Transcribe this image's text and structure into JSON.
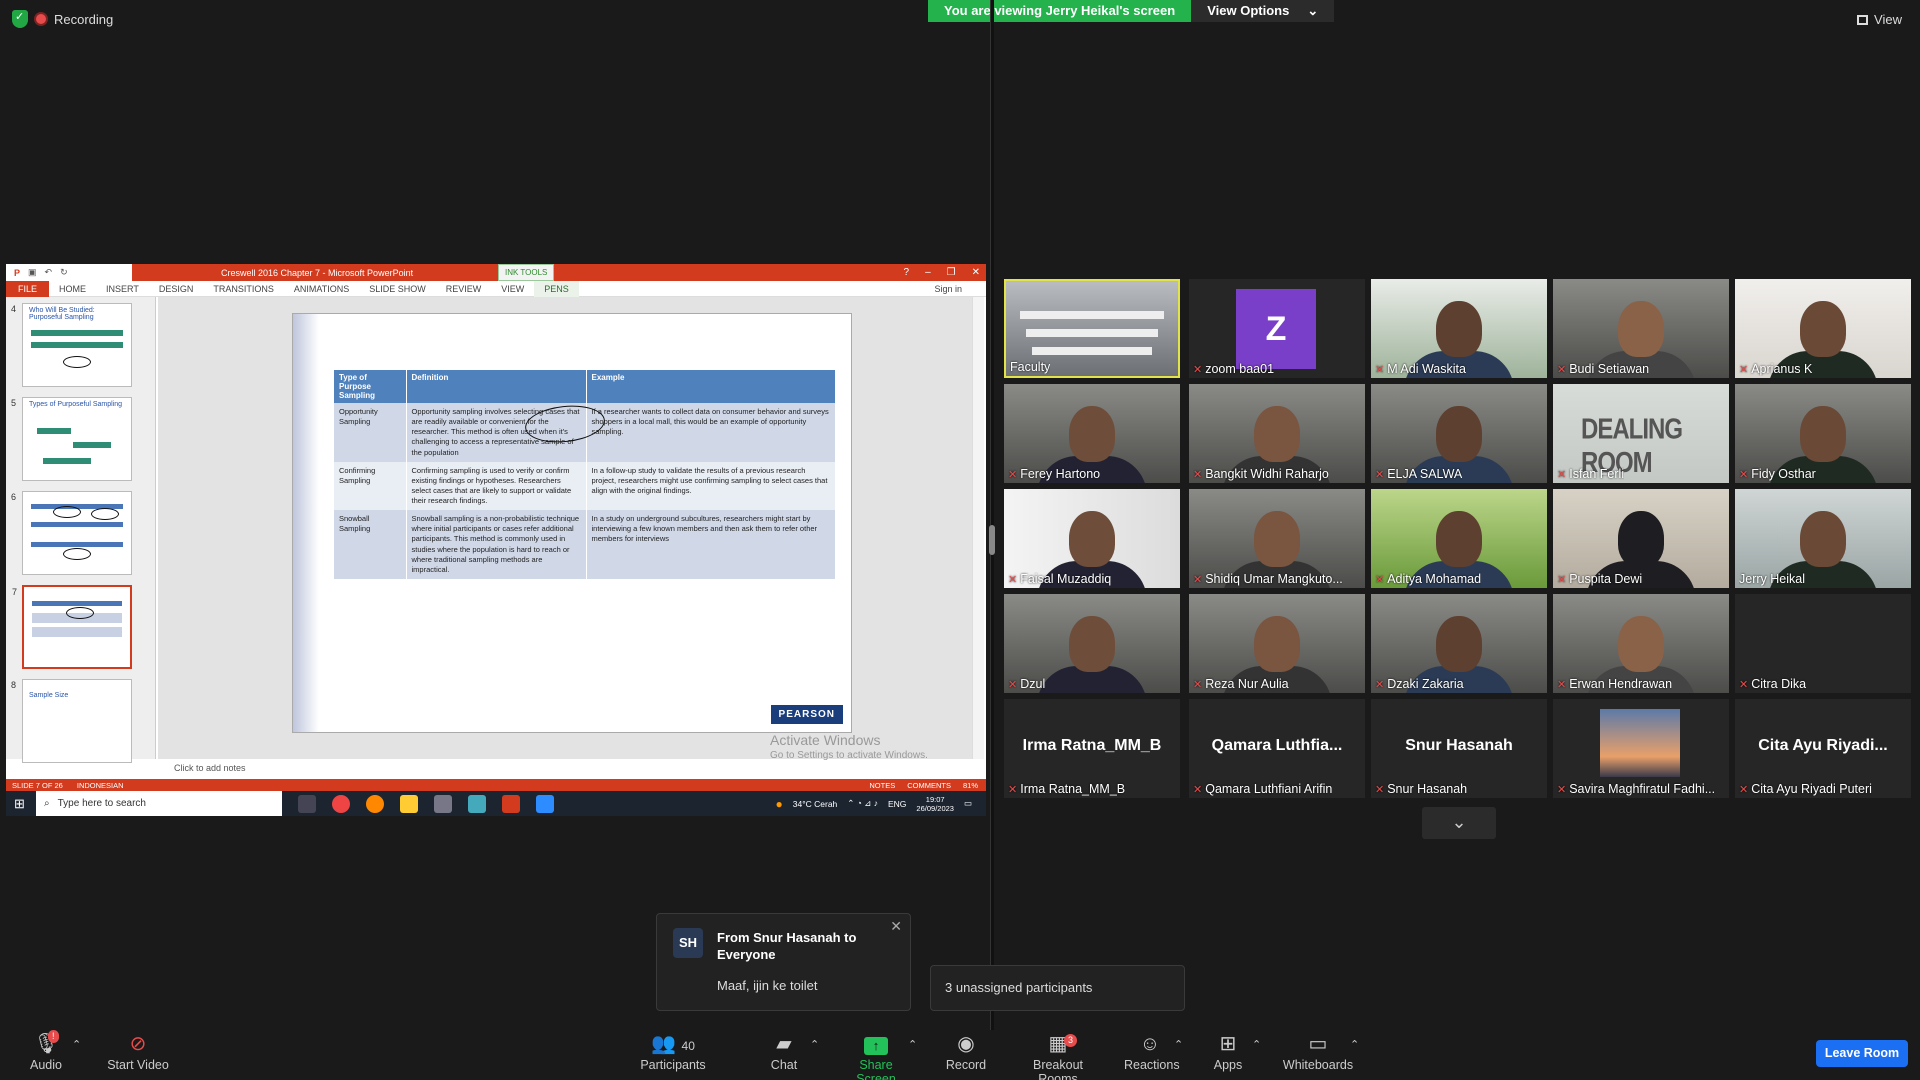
{
  "top": {
    "recording": "Recording",
    "viewing": "You are viewing Jerry Heikal's screen",
    "view_options": "View Options",
    "view": "View"
  },
  "ppt": {
    "title": "Creswell 2016 Chapter 7 - Microsoft PowerPoint",
    "ink_tools": "INK TOOLS",
    "tabs": [
      "FILE",
      "HOME",
      "INSERT",
      "DESIGN",
      "TRANSITIONS",
      "ANIMATIONS",
      "SLIDE SHOW",
      "REVIEW",
      "VIEW",
      "PENS"
    ],
    "sign_in": "Sign in",
    "thumbs": [
      {
        "num": "4",
        "title": "Who Will Be Studied: Purposeful Sampling"
      },
      {
        "num": "5",
        "title": "Types of Purposeful Sampling"
      },
      {
        "num": "6",
        "title": ""
      },
      {
        "num": "7",
        "title": ""
      },
      {
        "num": "8",
        "title": "Sample Size"
      }
    ],
    "table": {
      "headers": [
        "Type of Purpose Sampling",
        "Definition",
        "Example"
      ],
      "rows": [
        [
          "Opportunity Sampling",
          "Opportunity sampling involves selecting cases that are readily available or convenient for the researcher. This method is often used when it's challenging to access a representative sample of the population",
          "If a researcher wants to collect data on consumer behavior and surveys shoppers in a local mall, this would be an example of opportunity sampling."
        ],
        [
          "Confirming Sampling",
          "Confirming sampling is used to verify or confirm existing findings or hypotheses. Researchers select cases that are likely to support or validate their research findings.",
          "In a follow-up study to validate the results of a previous research project, researchers might use confirming sampling to select cases that align with the original findings."
        ],
        [
          "Snowball Sampling",
          "Snowball sampling is a non-probabilistic technique where initial participants or cases refer additional participants. This method is commonly used in studies where the population is hard to reach or where traditional sampling methods are impractical.",
          "In a study on underground subcultures, researchers might start by interviewing a few known members and then ask them to refer other members for interviews"
        ]
      ]
    },
    "pearson": "PEARSON",
    "notes": "Click to add notes",
    "activate": "Activate Windows",
    "activate_sub": "Go to Settings to activate Windows.",
    "status_slide": "SLIDE 7 OF 26",
    "status_lang": "INDONESIAN",
    "status_notes": "NOTES",
    "status_comments": "COMMENTS",
    "status_zoom": "81%",
    "taskbar_search": "Type here to search",
    "weather": "34°C Cerah",
    "lang": "ENG",
    "time": "19:07",
    "date": "26/09/2023"
  },
  "participants": [
    {
      "name": "Faculty",
      "muted": false,
      "kind": "room",
      "active": true
    },
    {
      "name": "zoom baa01",
      "muted": true,
      "kind": "avatar",
      "letter": "Z"
    },
    {
      "name": "M Adi Waskita",
      "muted": true,
      "kind": "plants"
    },
    {
      "name": "Budi Setiawan",
      "muted": true,
      "kind": "person"
    },
    {
      "name": "Aprianus K",
      "muted": true,
      "kind": "shelf"
    },
    {
      "name": "Ferey Hartono",
      "muted": true,
      "kind": "person"
    },
    {
      "name": "Bangkit Widhi Raharjo",
      "muted": true,
      "kind": "person"
    },
    {
      "name": "ELJA SALWA",
      "muted": true,
      "kind": "person"
    },
    {
      "name": "Isfan Ferli",
      "muted": true,
      "kind": "dealing",
      "bg_text": "DEALING ROOM"
    },
    {
      "name": "Fidy Osthar",
      "muted": true,
      "kind": "person"
    },
    {
      "name": "Faisal Muzaddiq",
      "muted": true,
      "kind": "art"
    },
    {
      "name": "Shidiq Umar Mangkuto...",
      "muted": true,
      "kind": "person"
    },
    {
      "name": "Aditya Mohamad",
      "muted": true,
      "kind": "green"
    },
    {
      "name": "Puspita Dewi",
      "muted": true,
      "kind": "hijab"
    },
    {
      "name": "Jerry Heikal",
      "muted": false,
      "kind": "lights"
    },
    {
      "name": "Dzul",
      "muted": true,
      "kind": "person"
    },
    {
      "name": "Reza Nur Aulia",
      "muted": true,
      "kind": "person"
    },
    {
      "name": "Dzaki Zakaria",
      "muted": true,
      "kind": "person"
    },
    {
      "name": "Erwan Hendrawan",
      "muted": true,
      "kind": "person"
    },
    {
      "name": "Citra Dika",
      "muted": true,
      "kind": "blank"
    },
    {
      "name": "Irma Ratna_MM_B",
      "muted": true,
      "kind": "text",
      "big": "Irma Ratna_MM_B"
    },
    {
      "name": "Qamara Luthfiani Arifin",
      "muted": true,
      "kind": "text",
      "big": "Qamara  Luthfia..."
    },
    {
      "name": "Snur Hasanah",
      "muted": true,
      "kind": "text",
      "big": "Snur Hasanah"
    },
    {
      "name": "Savira Maghfiratul Fadhi...",
      "muted": true,
      "kind": "sunset"
    },
    {
      "name": "Cita Ayu Riyadi Puteri",
      "muted": true,
      "kind": "text",
      "big": "Cita Ayu  Riyadi..."
    }
  ],
  "chat": {
    "initials": "SH",
    "from": "From Snur Hasanah to Everyone",
    "message": "Maaf, ijin ke toilet"
  },
  "unassigned": "3 unassigned participants",
  "toolbar": {
    "audio": "Audio",
    "audio_badge": "!",
    "video": "Start Video",
    "participants": "Participants",
    "participants_count": "40",
    "chat": "Chat",
    "share": "Share Screen",
    "record": "Record",
    "breakout": "Breakout Rooms",
    "breakout_badge": "3",
    "reactions": "Reactions",
    "apps": "Apps",
    "whiteboards": "Whiteboards",
    "leave": "Leave Room"
  }
}
